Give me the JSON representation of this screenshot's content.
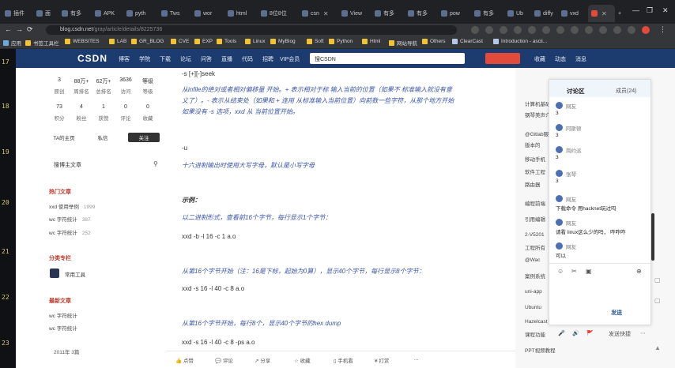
{
  "browser": {
    "tabs": [
      {
        "label": "插件"
      },
      {
        "label": "面"
      },
      {
        "label": "有多"
      },
      {
        "label": "APK"
      },
      {
        "label": "pyth"
      },
      {
        "label": "Tws"
      },
      {
        "label": "wor"
      },
      {
        "label": "html"
      },
      {
        "label": "8位8位"
      },
      {
        "label": "csn"
      },
      {
        "label": "View"
      },
      {
        "label": "有多"
      },
      {
        "label": "有多"
      },
      {
        "label": "pow"
      },
      {
        "label": "有多"
      },
      {
        "label": "Ub"
      },
      {
        "label": "diffy"
      },
      {
        "label": "vxd"
      },
      {
        "label": ""
      }
    ],
    "new_tab": "+",
    "url_host": "blog.csdn.net",
    "url_path": "/gray/article/details/8225736",
    "window_controls": [
      "—",
      "❐",
      "✕"
    ]
  },
  "bookmarks": [
    "应用",
    "书签工具栏",
    "WEBSITES",
    "LAB",
    "GR_BLOG",
    "CVE",
    "EXP",
    "Tools",
    "Linux",
    "MyBlog",
    "Soft",
    "Python",
    "Html",
    "网站导航",
    "Others",
    "ClearCast",
    "Introduction - ascii..."
  ],
  "line_numbers": [
    "17",
    "18",
    "19",
    "20",
    "21",
    "22",
    "23"
  ],
  "csdn": {
    "logo": "CSDN",
    "nav": [
      "博客",
      "学院",
      "下载",
      "论坛",
      "问答",
      "直播",
      "代码",
      "招聘",
      "VIP会员"
    ],
    "search_placeholder": "搜CSDN",
    "right": [
      "收藏",
      "动态",
      "消息"
    ]
  },
  "profile": {
    "stats_row1": [
      {
        "value": "3",
        "label": "原创"
      },
      {
        "value": "88万+",
        "label": "周排名"
      },
      {
        "value": "62万+",
        "label": "总排名"
      },
      {
        "value": "3636",
        "label": "访问"
      },
      {
        "value": "等级",
        "label": "等级"
      }
    ],
    "stats_row2": [
      {
        "value": "73",
        "label": "积分"
      },
      {
        "value": "4",
        "label": "粉丝"
      },
      {
        "value": "1",
        "label": "获赞"
      },
      {
        "value": "0",
        "label": "评论"
      },
      {
        "value": "0",
        "label": "收藏"
      }
    ],
    "btn_home": "TA的主页",
    "btn_msg": "私信",
    "btn_follow": "关注"
  },
  "search_link": "搜博主文章",
  "hot": {
    "heading": "热门文章",
    "items": [
      {
        "title": "xxd 使用举例",
        "count": "1999"
      },
      {
        "title": "wc 字符统计",
        "count": "387"
      },
      {
        "title": "wc 字符统计",
        "count": "252"
      }
    ]
  },
  "category": {
    "heading": "分类专栏",
    "name": "常用工具"
  },
  "recent": {
    "heading": "最新文章",
    "items": [
      "wc 字符统计",
      "wc 字符统计"
    ]
  },
  "archive": "2011年  3篇",
  "article": {
    "p1": "-s [+][-]seek",
    "p2": "从infile的绝对或者相对偏移量 开始。+ 表示相对于标 输入当前的位置（如果不 标准输入就没有意",
    "p3": "义了）。- 表示从结束处（如果和 + 连用 从标准输入当前位置）向前数一些字符，从那个地方开始",
    "p4": "如果没有 -s 选项，xxd 从 当前位置开始。",
    "p5": "-u",
    "p6": "十六进制输出时使用大写字母，默认是小写字母",
    "example_heading": "示例：",
    "p7": "以二进制形式，查看前16个字节，每行显示1个字节：",
    "code1": "xxd -b -l 16 -c 1 a.o",
    "p8": "从第16个字节开始（注：16是下标，起始为0算），显示40个字节，每行显示8个字节：",
    "code2": "xxd -s 16 -l 40 -c 8 a.o",
    "p9": "从第16个字节开始，每行8个，显示40个字节的hex dump",
    "code3": "xxd -s 16 -l 40 -c 8 -ps a.o"
  },
  "toolbar": [
    "点赞",
    "评论",
    "分享",
    "收藏",
    "手机看",
    "打赏",
    "..."
  ],
  "right_column": [
    "计算机基础",
    "钢琴美声介",
    "@Gitlab服务",
    "版本的",
    "移动手机",
    "软件工程",
    "路由器",
    "编程前端",
    "引用编辑",
    "2-V5201",
    "工程所有",
    "@Wac",
    "案例系统",
    "uni-app",
    "Ubuntu",
    "Hazelcast",
    "课程功能",
    "PPT视频教程"
  ],
  "discussion": {
    "tab_active": "讨论区",
    "tab_other": "成员(24)",
    "messages": [
      {
        "name": "网友",
        "text": "3"
      },
      {
        "name": "阿斯顿",
        "text": "3"
      },
      {
        "name": "简约派",
        "text": "3"
      },
      {
        "name": "张琴",
        "text": "3"
      },
      {
        "name": "网友",
        "text": "下载命令 用hacknet玩过吗"
      },
      {
        "name": "网友",
        "text": "请看 linux这么少的吗， 咋咋咋"
      },
      {
        "name": "网友",
        "text": "可以"
      }
    ],
    "send": "发送",
    "bottom": [
      "🎤",
      "🔊",
      "🚩",
      "发送快捷",
      "⋯"
    ]
  }
}
